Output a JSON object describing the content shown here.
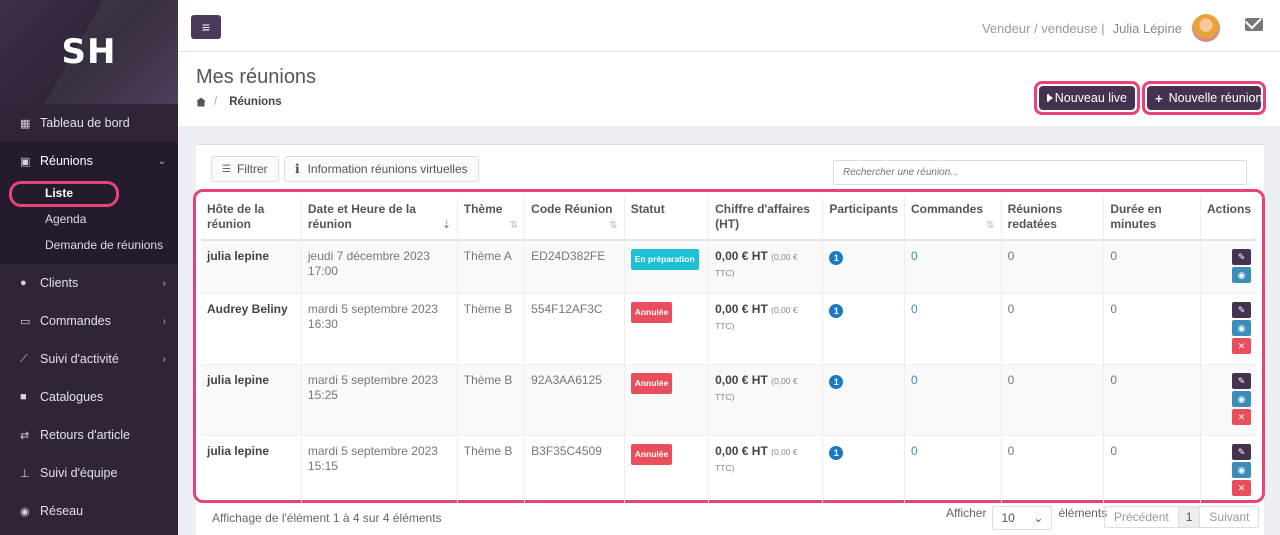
{
  "brand": {
    "logo": "SH"
  },
  "sidebar": {
    "items": [
      {
        "label": "Tableau de bord",
        "icon": "dashboard-icon"
      },
      {
        "label": "Réunions",
        "icon": "calendar-icon"
      },
      {
        "label": "Clients",
        "icon": "users-icon"
      },
      {
        "label": "Commandes",
        "icon": "credit-card-icon"
      },
      {
        "label": "Suivi d'activité",
        "icon": "line-chart-icon"
      },
      {
        "label": "Catalogues",
        "icon": "book-icon"
      },
      {
        "label": "Retours d'article",
        "icon": "exchange-icon"
      },
      {
        "label": "Suivi d'équipe",
        "icon": "sitemap-icon"
      },
      {
        "label": "Réseau",
        "icon": "globe-icon"
      }
    ],
    "reunions_sub": [
      "Liste",
      "Agenda",
      "Demande de réunions"
    ]
  },
  "topbar": {
    "role": "Vendeur / vendeuse |",
    "user": "Julia Lépine"
  },
  "header": {
    "title": "Mes réunions",
    "breadcrumb": "Réunions",
    "btn_live": "Nouveau live",
    "btn_new": "Nouvelle réunion"
  },
  "toolbar": {
    "filter": "Filtrer",
    "info": "Information réunions virtuelles",
    "search_placeholder": "Rechercher une réunion..."
  },
  "table": {
    "headers": [
      "Hôte de la réunion",
      "Date et Heure de la réunion",
      "Thème",
      "Code Réunion",
      "Statut",
      "Chiffre d'affaires (HT)",
      "Participants",
      "Commandes",
      "Réunions redatées",
      "Durée en minutes",
      "Actions"
    ],
    "rows": [
      {
        "host": "julia lepine",
        "date": "jeudi 7 décembre 2023 17:00",
        "theme": "Thème A",
        "code": "ED24D382FE",
        "status": "En préparation",
        "ca": "0,00 € HT",
        "ttc": "(0,00 € TTC)",
        "participants": "1",
        "commandes": "0",
        "redatees": "0",
        "duree": "0"
      },
      {
        "host": "Audrey Beliny",
        "date": "mardi 5 septembre 2023 16:30",
        "theme": "Thème B",
        "code": "554F12AF3C",
        "status": "Annulée",
        "ca": "0,00 € HT",
        "ttc": "(0,00 € TTC)",
        "participants": "1",
        "commandes": "0",
        "redatees": "0",
        "duree": "0"
      },
      {
        "host": "julia lepine",
        "date": "mardi 5 septembre 2023 15:25",
        "theme": "Thème B",
        "code": "92A3AA6125",
        "status": "Annulée",
        "ca": "0,00 € HT",
        "ttc": "(0,00 € TTC)",
        "participants": "1",
        "commandes": "0",
        "redatees": "0",
        "duree": "0"
      },
      {
        "host": "julia lepine",
        "date": "mardi 5 septembre 2023 15:15",
        "theme": "Thème B",
        "code": "B3F35C4509",
        "status": "Annulée",
        "ca": "0,00 € HT",
        "ttc": "(0,00 € TTC)",
        "participants": "1",
        "commandes": "0",
        "redatees": "0",
        "duree": "0"
      }
    ]
  },
  "footer": {
    "info": "Affichage de l'élément 1 à 4 sur 4 éléments",
    "show": "Afficher",
    "length": "10",
    "elements": "éléments",
    "prev": "Précédent",
    "page": "1",
    "next": "Suivant"
  },
  "colors": {
    "sidebar": "#2f2438",
    "accent": "#43334f",
    "highlight": "#e84378",
    "prep": "#1ec0d4",
    "cancelled": "#e84e5c",
    "link": "#3c8dbc"
  }
}
